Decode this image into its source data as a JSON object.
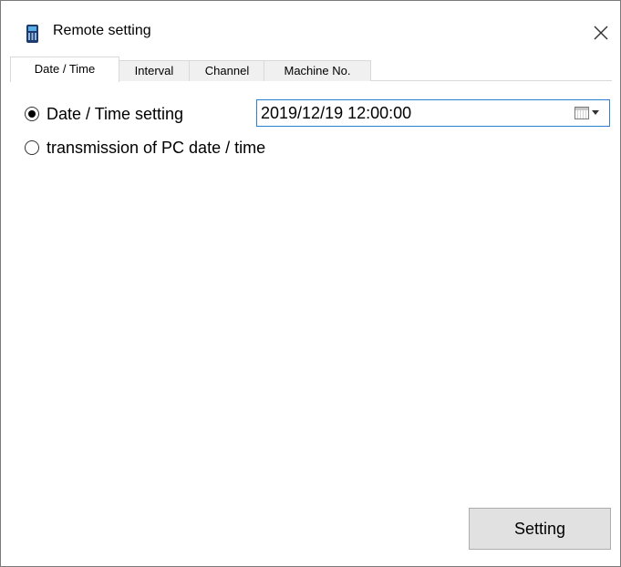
{
  "window": {
    "title": "Remote setting",
    "app_icon": "calculator-device-icon",
    "close_icon": "close-icon"
  },
  "tabs": [
    {
      "label": "Date / Time",
      "active": true
    },
    {
      "label": "Interval",
      "active": false
    },
    {
      "label": "Channel",
      "active": false
    },
    {
      "label": "Machine No.",
      "active": false
    }
  ],
  "date_time_panel": {
    "option_date_time_setting": {
      "label": "Date / Time setting",
      "selected": true
    },
    "option_pc_transmission": {
      "label": "transmission of PC date / time",
      "selected": false
    },
    "datetime_value": "2019/12/19 12:00:00",
    "calendar_icon": "calendar-dropdown-icon"
  },
  "footer": {
    "setting_label": "Setting"
  },
  "colors": {
    "field_border_focus": "#2d7fd1",
    "button_bg": "#e1e1e1",
    "tab_inactive_bg": "#f0f0f0",
    "app_icon_body": "#1c3b6e",
    "app_icon_screen": "#5ab0e6"
  }
}
